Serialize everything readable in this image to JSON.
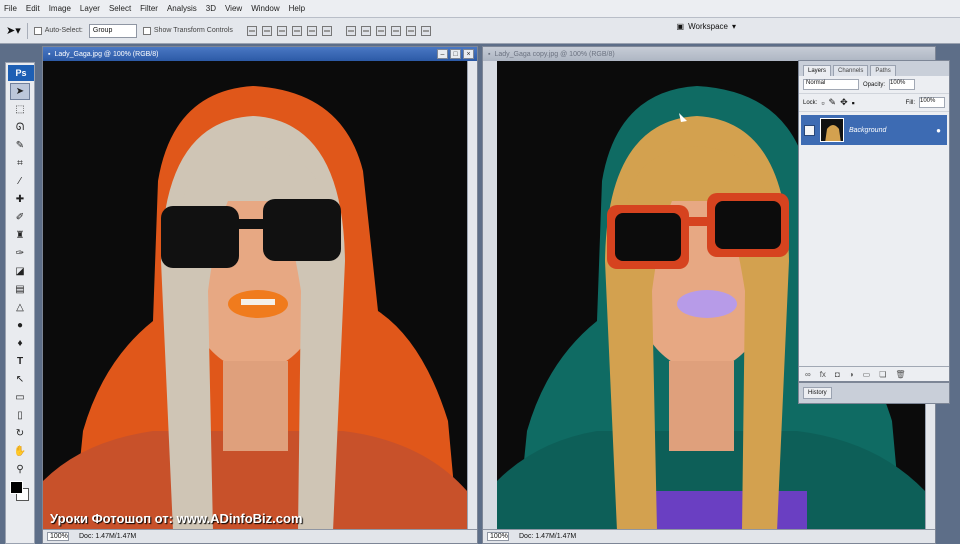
{
  "menu": [
    "File",
    "Edit",
    "Image",
    "Layer",
    "Select",
    "Filter",
    "Analysis",
    "3D",
    "View",
    "Window",
    "Help"
  ],
  "options": {
    "auto_select_label": "Auto-Select:",
    "auto_select_value": "Group",
    "transform_label": "Show Transform Controls",
    "workspace": "Workspace"
  },
  "toolbox": {
    "logo": "Ps",
    "tools": [
      "move-tool-icon",
      "marquee-tool-icon",
      "lasso-tool-icon",
      "quick-select-tool-icon",
      "crop-tool-icon",
      "eyedropper-tool-icon",
      "healing-tool-icon",
      "brush-tool-icon",
      "clone-stamp-tool-icon",
      "history-brush-tool-icon",
      "eraser-tool-icon",
      "gradient-tool-icon",
      "blur-tool-icon",
      "dodge-tool-icon",
      "pen-tool-icon",
      "type-tool-icon",
      "path-select-tool-icon",
      "shape-tool-icon",
      "notes-tool-icon",
      "3d-rotate-tool-icon",
      "hand-tool-icon",
      "zoom-tool-icon"
    ]
  },
  "documents": [
    {
      "title": "Lady_Gaga.jpg @ 100% (RGB/8)",
      "zoom": "100%",
      "doc_info": "Doc: 1.47M/1.47M"
    },
    {
      "title": "Lady_Gaga copy.jpg @ 100% (RGB/8)",
      "zoom": "100%",
      "doc_info": "Doc: 1.47M/1.47M"
    }
  ],
  "layers_panel": {
    "tabs": [
      "Layers",
      "Channels",
      "Paths"
    ],
    "blend_mode": "Normal",
    "opacity_label": "Opacity:",
    "opacity": "100%",
    "lock_label": "Lock:",
    "fill_label": "Fill:",
    "fill": "100%",
    "layer_name": "Background"
  },
  "history_tab": "History",
  "watermark": "Уроки Фотошоп от: www.ADinfoBiz.com"
}
